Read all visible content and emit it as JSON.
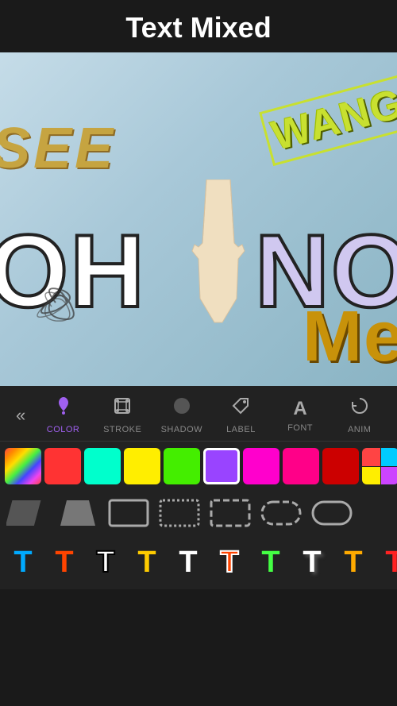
{
  "header": {
    "title": "Text Mixed"
  },
  "canvas": {
    "texts": {
      "see": "SEE",
      "wang": "WANG",
      "oh": "OH",
      "no": "NO",
      "me": "Me"
    }
  },
  "tools": {
    "back_icon": "«",
    "items": [
      {
        "id": "color",
        "label": "COLOR",
        "icon": "💧",
        "active": true
      },
      {
        "id": "stroke",
        "label": "STROKE",
        "icon": "⊞",
        "active": false
      },
      {
        "id": "shadow",
        "label": "SHADOW",
        "icon": "◑",
        "active": false
      },
      {
        "id": "label",
        "label": "LABEL",
        "icon": "▶",
        "active": false
      },
      {
        "id": "font",
        "label": "FONT",
        "icon": "A",
        "active": false
      },
      {
        "id": "anim",
        "label": "ANIM",
        "icon": "↻",
        "active": false
      }
    ]
  },
  "swatches": [
    {
      "id": "rainbow",
      "type": "rainbow"
    },
    {
      "id": "red",
      "color": "#ff3333"
    },
    {
      "id": "cyan",
      "color": "#00ffcc"
    },
    {
      "id": "yellow",
      "color": "#ffee00"
    },
    {
      "id": "green",
      "color": "#44ee00"
    },
    {
      "id": "purple",
      "color": "#9944ff",
      "selected": true
    },
    {
      "id": "magenta",
      "color": "#ff00cc"
    },
    {
      "id": "hotpink",
      "color": "#ff0088"
    },
    {
      "id": "pink",
      "color": "#ff88aa"
    },
    {
      "id": "darkred",
      "color": "#cc0000"
    },
    {
      "id": "multi",
      "type": "multi",
      "colors": [
        "#ff4444",
        "#00ccff",
        "#ffee00",
        "#cc44ff"
      ]
    }
  ],
  "shapes": [
    {
      "id": "parallelogram-dark",
      "label": "parallelogram dark"
    },
    {
      "id": "trapezoid",
      "label": "trapezoid"
    },
    {
      "id": "rectangle-outline",
      "label": "rectangle outline"
    },
    {
      "id": "rectangle-dotted",
      "label": "rectangle dotted"
    },
    {
      "id": "rectangle-dashed",
      "label": "rectangle dashed"
    },
    {
      "id": "rounded-dashed",
      "label": "rounded dashed"
    },
    {
      "id": "pill-outline",
      "label": "pill outline"
    }
  ],
  "font_styles": [
    {
      "id": "t1",
      "char": "T",
      "color": "#00aaff"
    },
    {
      "id": "t2",
      "char": "T",
      "color": "#ff4400"
    },
    {
      "id": "t3",
      "char": "T",
      "color": "#ffffff",
      "stroke": "#000000"
    },
    {
      "id": "t4",
      "char": "T",
      "color": "#ffcc00"
    },
    {
      "id": "t5",
      "char": "T",
      "color": "#ffffff"
    },
    {
      "id": "t6",
      "char": "T",
      "color": "#ff4400",
      "stroke": "#ffffff"
    },
    {
      "id": "t7",
      "char": "T",
      "color": "#44ff44"
    },
    {
      "id": "t8",
      "char": "T",
      "color": "#ffffff",
      "shadow": true
    },
    {
      "id": "t9",
      "char": "T",
      "color": "#ffaa00"
    },
    {
      "id": "t10",
      "char": "T",
      "color": "#ff2222"
    }
  ],
  "colors": {
    "background": "#222222",
    "accent": "#a060f0"
  }
}
